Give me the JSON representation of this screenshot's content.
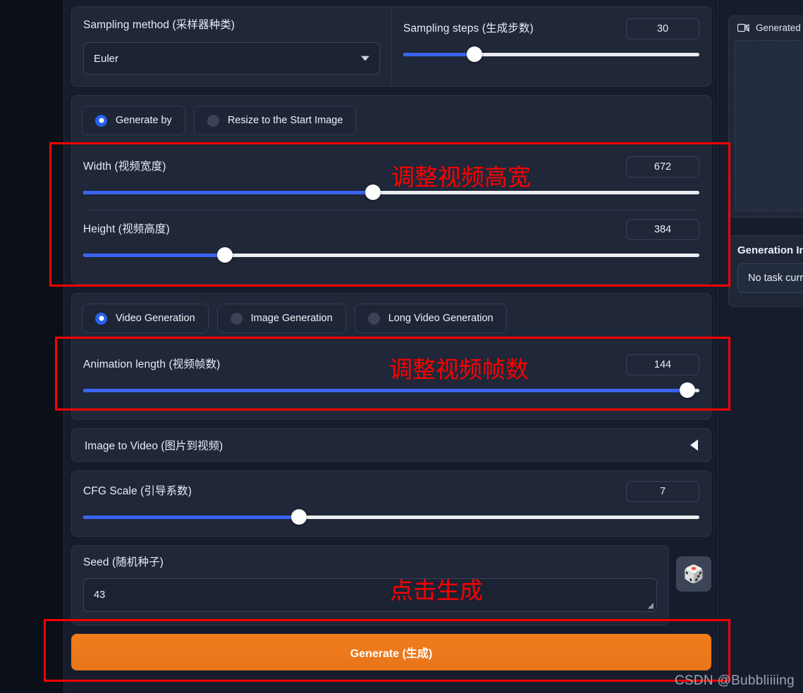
{
  "sampling": {
    "method_label": "Sampling method (采样器种类)",
    "method_value": "Euler",
    "steps_label": "Sampling steps (生成步数)",
    "steps_value": "30"
  },
  "size_mode": {
    "options": [
      {
        "label": "Generate by",
        "selected": true
      },
      {
        "label": "Resize to the Start Image",
        "selected": false
      }
    ]
  },
  "dimensions": {
    "width_label": "Width (视频宽度)",
    "width_value": "672",
    "height_label": "Height (视频高度)",
    "height_value": "384"
  },
  "gen_mode": {
    "options": [
      {
        "label": "Video Generation",
        "selected": true
      },
      {
        "label": "Image Generation",
        "selected": false
      },
      {
        "label": "Long Video Generation",
        "selected": false
      }
    ]
  },
  "animation": {
    "length_label": "Animation length (视频帧数)",
    "length_value": "144"
  },
  "accordion": {
    "image_to_video_label": "Image to Video (图片到视频)",
    "arrow_icon": "triangle-left-icon"
  },
  "cfg": {
    "label": "CFG Scale (引导系数)",
    "value": "7"
  },
  "seed": {
    "label": "Seed (随机种子)",
    "value": "43",
    "dice_icon": "🎲"
  },
  "generate": {
    "label": "Generate (生成)"
  },
  "right_panel": {
    "generated_title": "Generated An",
    "video_icon": "video-camera-off-icon",
    "info_title": "Generation Inf",
    "info_text": "No task curr"
  },
  "annotations": {
    "note_size": "调整视频高宽",
    "note_frames": "调整视频帧数",
    "note_generate": "点击生成",
    "watermark": "CSDN @Bubbliiiing",
    "accent_red": "#ff0000"
  },
  "colors": {
    "slider_fill": "#3b64f0",
    "radio_on": "#2563eb",
    "generate_bg": "#ef7c1e"
  },
  "slider_positions": {
    "steps_pct": 24,
    "width_pct": 47,
    "height_pct": 23,
    "animation_pct": 98,
    "cfg_pct": 35
  }
}
